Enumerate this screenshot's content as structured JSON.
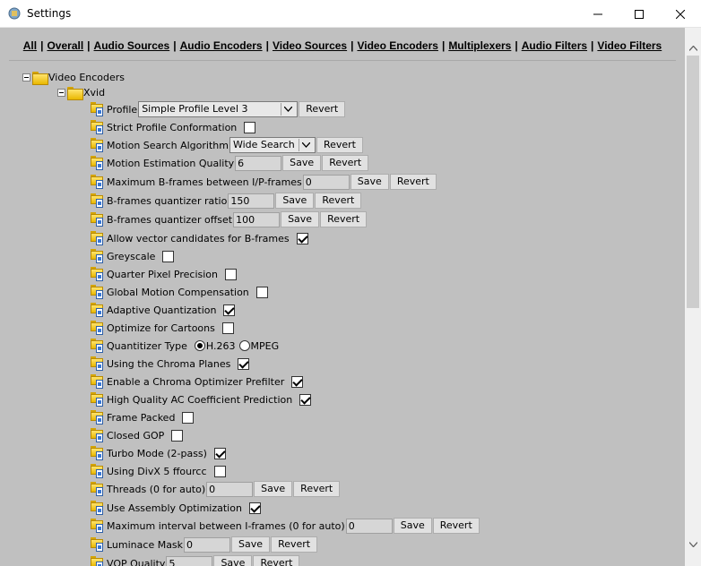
{
  "window": {
    "title": "Settings"
  },
  "nav": [
    {
      "label": "All"
    },
    {
      "label": "Overall"
    },
    {
      "label": "Audio Sources"
    },
    {
      "label": "Audio Encoders"
    },
    {
      "label": "Video Sources"
    },
    {
      "label": "Video Encoders"
    },
    {
      "label": "Multiplexers"
    },
    {
      "label": "Audio Filters"
    },
    {
      "label": "Video Filters"
    }
  ],
  "tree": {
    "root": "Video Encoders",
    "child": "Xvid"
  },
  "buttons": {
    "save": "Save",
    "revert": "Revert"
  },
  "settings": {
    "profile": {
      "label": "Profile",
      "value": "Simple Profile Level 3"
    },
    "strict_profile": {
      "label": "Strict Profile Conformation",
      "checked": false
    },
    "motion_search": {
      "label": "Motion Search Algorithm",
      "value": "Wide Search"
    },
    "motion_quality": {
      "label": "Motion Estimation Quality",
      "value": "6"
    },
    "max_bframes": {
      "label": "Maximum B-frames between I/P-frames",
      "value": "0"
    },
    "bframes_ratio": {
      "label": "B-frames quantizer ratio",
      "value": "150"
    },
    "bframes_offset": {
      "label": "B-frames quantizer offset",
      "value": "100"
    },
    "vector_candidates": {
      "label": "Allow vector candidates for B-frames",
      "checked": true
    },
    "greyscale": {
      "label": "Greyscale",
      "checked": false
    },
    "qpel": {
      "label": "Quarter Pixel Precision",
      "checked": false
    },
    "gmc": {
      "label": "Global Motion Compensation",
      "checked": false
    },
    "adaptive_quant": {
      "label": "Adaptive Quantization",
      "checked": true
    },
    "cartoons": {
      "label": "Optimize for Cartoons",
      "checked": false
    },
    "quant_type": {
      "label": "Quantitizer Type",
      "option1": "H.263",
      "option2": "MPEG",
      "selected": "H.263"
    },
    "chroma_planes": {
      "label": "Using the Chroma Planes",
      "checked": true
    },
    "chroma_optimizer": {
      "label": "Enable a Chroma Optimizer Prefilter",
      "checked": true
    },
    "hq_ac": {
      "label": "High Quality AC Coefficient Prediction",
      "checked": true
    },
    "frame_packed": {
      "label": "Frame Packed",
      "checked": false
    },
    "closed_gop": {
      "label": "Closed GOP",
      "checked": false
    },
    "turbo": {
      "label": "Turbo Mode (2-pass)",
      "checked": true
    },
    "divx5": {
      "label": "Using DivX 5 ffourcc",
      "checked": false
    },
    "threads": {
      "label": "Threads (0 for auto)",
      "value": "0"
    },
    "asm_opt": {
      "label": "Use Assembly Optimization",
      "checked": true
    },
    "max_iframe": {
      "label": "Maximum interval between I-frames (0 for auto)",
      "value": "0"
    },
    "lumi_mask": {
      "label": "Luminace Mask",
      "value": "0"
    },
    "vop_quality": {
      "label": "VOP Quality",
      "value": "5"
    }
  }
}
